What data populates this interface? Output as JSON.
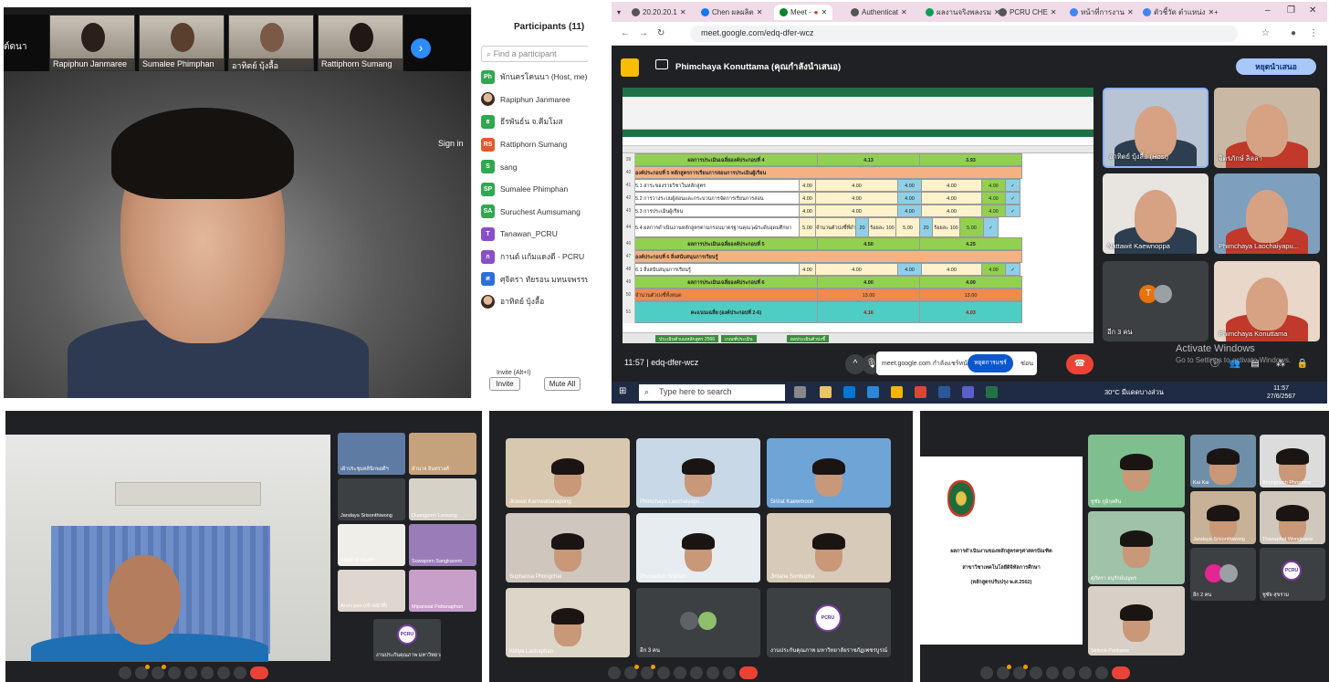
{
  "zoom": {
    "top_name": "ต์ดนา",
    "thumbnails": [
      {
        "name": "Rapiphun Janmaree"
      },
      {
        "name": "Sumalee Phimphan"
      },
      {
        "name": "อาทิตย์ บุ้งลื้อ"
      },
      {
        "name": "Rattiphorn Sumang"
      }
    ],
    "sign_in": "Sign in",
    "participants_title": "Participants (11)",
    "search_placeholder": "Find a participant",
    "participants": [
      {
        "initials": "Ph",
        "color": "#2fa84f",
        "name": "พักนครโคนนา (Host, me)",
        "photo": false
      },
      {
        "initials": "",
        "color": "",
        "name": "Rapiphun Janmaree",
        "photo": true
      },
      {
        "initials": "ธ",
        "color": "#2fa84f",
        "name": "ธีรพันธ์น จ.คีมโมส",
        "photo": false
      },
      {
        "initials": "RS",
        "color": "#e05a2b",
        "name": "Rattiphorn Sumang",
        "photo": false
      },
      {
        "initials": "S",
        "color": "#2fa84f",
        "name": "sang",
        "photo": false
      },
      {
        "initials": "SP",
        "color": "#2fa84f",
        "name": "Sumalee Phimphan",
        "photo": false
      },
      {
        "initials": "SA",
        "color": "#2fa84f",
        "name": "Suruchest Aumsumang",
        "photo": false
      },
      {
        "initials": "T",
        "color": "#8a4fc7",
        "name": "Tanawan_PCRU",
        "photo": false
      },
      {
        "initials": "ก",
        "color": "#8a4fc7",
        "name": "กานต์ แก้มแดงดี - PCRU",
        "photo": false
      },
      {
        "initials": "ศ",
        "color": "#2d6fd8",
        "name": "ศุจิตรา ทัยรอน มหนจพรรษร์",
        "photo": false
      },
      {
        "initials": "",
        "color": "",
        "name": "อาทิตย์ บุ้งลื้อ",
        "photo": true
      }
    ],
    "invite_hint": "Invite (Alt+I)",
    "invite_label": "Invite",
    "mute_all_label": "Mute All"
  },
  "meet_browser": {
    "tabs": [
      "20.20.20.1",
      "Chen ผลผลิต",
      "Meet -",
      "Authenticat",
      "ผลงานจริงพลงรม",
      "PCRU CHE",
      "หน้าที่การงาน",
      "ตัวชี้วัด ตำแหน่ง"
    ],
    "new_tab": "+",
    "url": "meet.google.com/edq-dfer-wcz",
    "presenter": "Phimchaya Konuttama (คุณกำลังนำเสนอ)",
    "present_button": "หยุดนำเสนอ",
    "sheet": {
      "rows": [
        {
          "n": "39",
          "cells": [
            "ผลการประเมินเฉลี่ยองค์ประกอบที่ 4",
            "4.13",
            "3.93"
          ],
          "type": "total"
        },
        {
          "n": "40",
          "cells": [
            "องค์ประกอบที่ 5 หลักสูตรการเรียนการสอนการประเมินผู้เรียน"
          ],
          "type": "section"
        },
        {
          "n": "41",
          "cells": [
            "5.1 สาระของรายวิชาในหลักสูตร",
            "4.00",
            "4.00",
            "4.00",
            "4.00",
            "4.00",
            "✓"
          ],
          "type": "data"
        },
        {
          "n": "42",
          "cells": [
            "5.2 การวางระบบผู้สอนและกระบวนการจัดการเรียนการสอน",
            "4.00",
            "4.00",
            "4.00",
            "4.00",
            "4.00",
            "✓"
          ],
          "type": "data"
        },
        {
          "n": "43",
          "cells": [
            "5.3 การประเมินผู้เรียน",
            "4.00",
            "4.00",
            "4.00",
            "4.00",
            "4.00",
            "✓"
          ],
          "type": "data"
        },
        {
          "n": "44",
          "cells": [
            "5.4 ผลการดำเนินงานหลักสูตรตามกรอบมาตรฐานคุณวุฒิระดับอุดมศึกษา",
            "5.00",
            "จำนวนตัวบ่งชี้ที่ดำเนินการ",
            "20",
            "ร้อยละ 100",
            "5.00",
            "20",
            "ร้อยละ 100",
            "5.00",
            "✓"
          ],
          "type": "data"
        },
        {
          "n": "46",
          "cells": [
            "ผลการประเมินเฉลี่ยองค์ประกอบที่ 5",
            "4.50",
            "4.25"
          ],
          "type": "total"
        },
        {
          "n": "47",
          "cells": [
            "องค์ประกอบที่ 6 สิ่งสนับสนุนการเรียนรู้"
          ],
          "type": "section2"
        },
        {
          "n": "48",
          "cells": [
            "6.1 สิ่งสนับสนุนการเรียนรู้",
            "4.00",
            "4.00",
            "4.00",
            "4.00",
            "4.00",
            "✓"
          ],
          "type": "data"
        },
        {
          "n": "49",
          "cells": [
            "ผลการประเมินเฉลี่ยองค์ประกอบที่ 6",
            "4.00",
            "4.00"
          ],
          "type": "total"
        },
        {
          "n": "50",
          "cells": [
            "จำนวนตัวบ่งชี้ทั้งหมด",
            "13.00",
            "13.00"
          ],
          "type": "count"
        },
        {
          "n": "51",
          "cells": [
            "คะแนนเฉลี่ย (องค์ประกอบที่ 2-6)",
            "4.16",
            "4.03"
          ],
          "type": "avg"
        }
      ],
      "sheet_tabs": [
        "ประเมินตัวเองหลักสูตร 2566",
        "เกณฑ์ประเมิน",
        "ผลประเมินตัวบ่งชี้"
      ]
    },
    "tiles": [
      {
        "name": "อาทิตย์ บุ้งลื้อ (Host)"
      },
      {
        "name": "จิตรภักษ์ ลิลลา"
      },
      {
        "name": "Nattawit Kaewnoppa"
      },
      {
        "name": "Phimchaya Laochaiyapu..."
      },
      {
        "name": "อีก 3 คน",
        "avatar": "T"
      },
      {
        "name": "Phimchaya Konuttama"
      }
    ],
    "meeting_code": "11:57 | edq-dfer-wcz",
    "share_text": "meet.google.com กำลังแชร์หน้าจอ",
    "share_stop": "หยุดการแชร์",
    "share_hide": "ซ่อน",
    "activate_title": "Activate Windows",
    "activate_sub": "Go to Settings to activate Windows.",
    "taskbar_search": "Type here to search",
    "weather": "30°C มีแดดบางส่วน",
    "clock_time": "11:57",
    "clock_date": "27/6/2567"
  },
  "meet_panel3": {
    "tiles": [
      {
        "name": "เฝ้าประชุมคลินิกพอดีฯ"
      },
      {
        "name": "อำนาจ อินทรวงศ์"
      },
      {
        "name": "Jandaya Srisonthiwong"
      },
      {
        "name": "Duangporn Lansang"
      },
      {
        "name": "จิตรภักษ์ ทองคำ"
      },
      {
        "name": "Suwaporn Sangkasem"
      },
      {
        "name": "Aruni pan (เจ้าหน้าที่)"
      },
      {
        "name": "Mipanwat Pattanaphon"
      },
      {
        "name": "งานประกันคุณภาพ มหาวิทยาลัย"
      }
    ],
    "logo_text": "PCRU"
  },
  "meet_panel4": {
    "tiles": [
      {
        "name": "Jirawat Karnwattanapong"
      },
      {
        "name": "Phimchaya Laochaiyapu..."
      },
      {
        "name": "Sirirat Kaewmoon"
      },
      {
        "name": "Suphansa Phongchai"
      },
      {
        "name": "Phuwadon Sriphan"
      },
      {
        "name": "Jintana Sonbupha"
      },
      {
        "name": "Kittiya Laohaphan"
      },
      {
        "name": "อีก 3 คน"
      },
      {
        "name": "งานประกันคุณภาพ มหาวิทยาลัยราชภัฏเพชรบูรณ์"
      }
    ],
    "logo_text": "PCRU"
  },
  "meet_panel5": {
    "doc_lines": [
      "ผลการดำเนินงานของหลักสูตรครุศาสตรบัณฑิต",
      "สาขาวิชาเทคโนโลยีดิจิทัลการศึกษา",
      "(หลักสูตรปรับปรุง พ.ศ.2562)"
    ],
    "tiles": [
      {
        "name": "ชูชัย ภูมิกุลสิน"
      },
      {
        "name": "Kai Kai"
      },
      {
        "name": "Anongnuch Phromma"
      },
      {
        "name": "ศุภัตรา อนุรักษ์บุญพร"
      },
      {
        "name": "Jandaya Srisonthiwong"
      },
      {
        "name": "Thanaphat Wongkaew"
      },
      {
        "name": "Siriluck Pankaew"
      },
      {
        "name": "อีก 2 คน"
      },
      {
        "name": "ชูชัย สุขราม"
      }
    ],
    "logo_text": "PCRU"
  }
}
